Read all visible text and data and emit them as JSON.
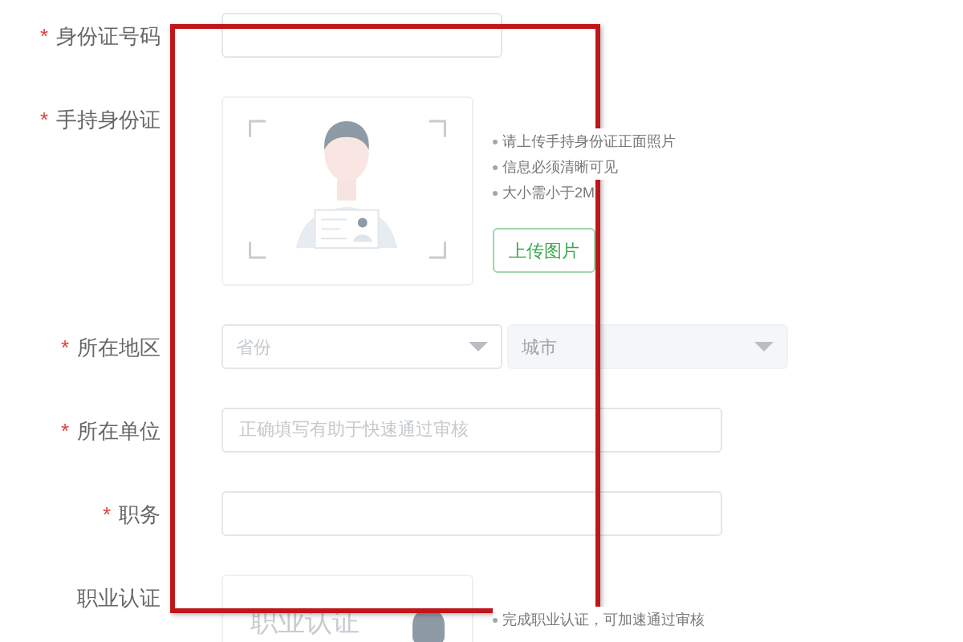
{
  "form": {
    "fields": [
      {
        "kind": "text",
        "label": "身份证号码",
        "mark": "*",
        "wide": false
      },
      {
        "kind": "upload",
        "label": "手持身份证",
        "mark": "*",
        "tips": [
          "请上传手持身份证正面照片",
          "信息必须清晰可见",
          "大小需小于2M"
        ],
        "button": "上传图片"
      },
      {
        "kind": "selects",
        "label": "所在地区",
        "mark": "*",
        "selects": [
          {
            "placeholder": "省份",
            "disabled": false
          },
          {
            "placeholder": "城市",
            "disabled": true
          }
        ]
      },
      {
        "kind": "text",
        "label": "所在单位",
        "mark": "*",
        "wide": true,
        "placeholder": "正确填写有助于快速通过审核"
      },
      {
        "kind": "text",
        "label": "职务",
        "mark": "*",
        "wide": true
      },
      {
        "kind": "upload",
        "label": "职业认证",
        "card_text": "职业认证",
        "tips": [
          "完成职业认证，可加速通过审核"
        ]
      }
    ]
  }
}
